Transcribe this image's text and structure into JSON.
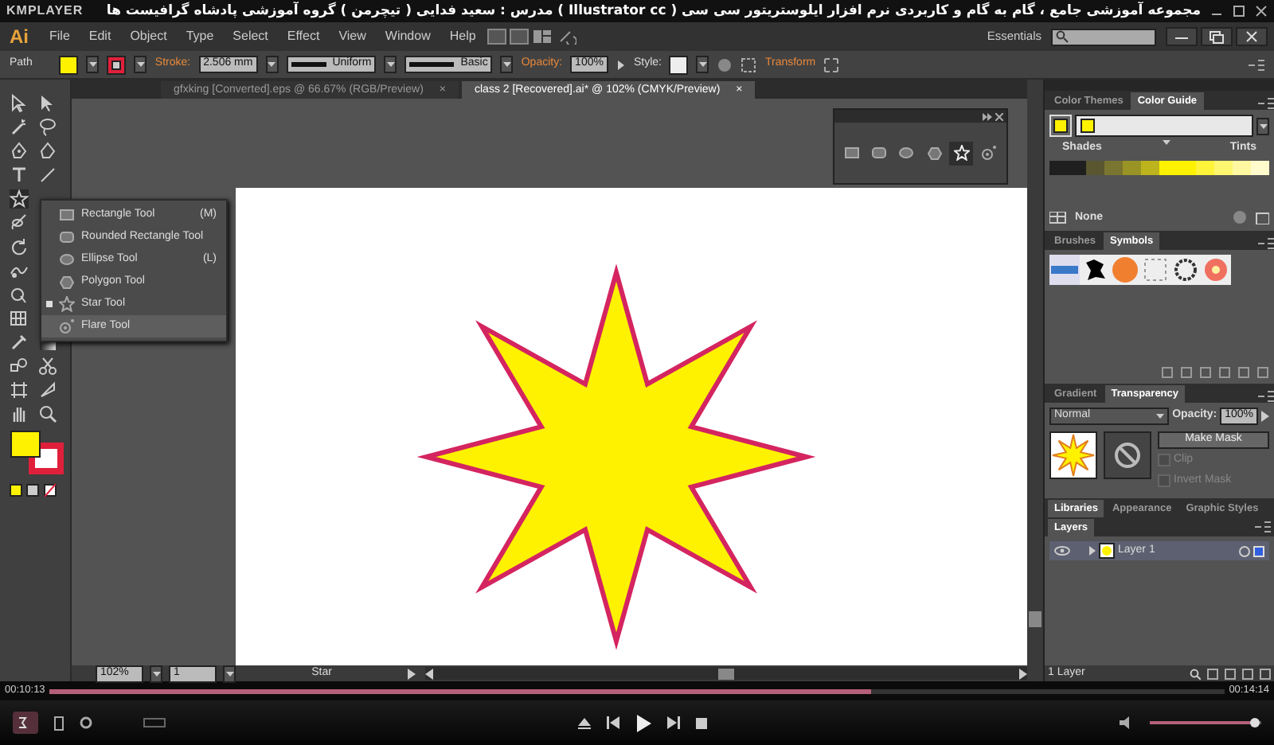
{
  "player": {
    "name": "KMPLAYER",
    "title": "مجموعه آموزشی جامع ، گام به گام و کاربردی نرم افزار ایلوستریتور سی سی ( Illustrator cc ) مدرس : سعید فدایی ( تیچرمن ) گروه آموزشی پادشاه گرافیست ها",
    "elapsed": "00:10:13",
    "total": "00:14:14",
    "progress": {
      "level": 0.7
    },
    "volume": {
      "level": 0.9
    }
  },
  "app": {
    "logo": "Ai",
    "menus": [
      "File",
      "Edit",
      "Object",
      "Type",
      "Select",
      "Effect",
      "View",
      "Window",
      "Help"
    ],
    "workspace": "Essentials"
  },
  "control_bar": {
    "selection": "Path",
    "stroke_label": "Stroke:",
    "stroke_weight": "2.506 mm",
    "profile": "Uniform",
    "brush": "Basic",
    "opacity_label": "Opacity:",
    "opacity": "100%",
    "style_label": "Style:",
    "transform": "Transform"
  },
  "documents": [
    {
      "title": "gfxking [Converted].eps @ 66.67% (RGB/Preview)",
      "close": "×",
      "selected": false
    },
    {
      "title": "class 2 [Recovered].ai* @ 102% (CMYK/Preview)",
      "close": "×",
      "selected": true
    }
  ],
  "flyout": [
    {
      "kind": "rect",
      "label": "Rectangle Tool",
      "shortcut": "(M)",
      "current": false,
      "hovered": false
    },
    {
      "kind": "rounded",
      "label": "Rounded Rectangle Tool",
      "current": false,
      "hovered": false
    },
    {
      "kind": "ellipse",
      "label": "Ellipse Tool",
      "shortcut": "(L)",
      "current": false,
      "hovered": false
    },
    {
      "kind": "polygon",
      "label": "Polygon Tool",
      "current": false,
      "hovered": false
    },
    {
      "kind": "star",
      "label": "Star Tool",
      "current": true,
      "hovered": false
    },
    {
      "kind": "flare",
      "label": "Flare Tool",
      "current": false,
      "hovered": true
    }
  ],
  "tearoff": [
    {
      "kind": "rect",
      "selected": false
    },
    {
      "kind": "rounded",
      "selected": false
    },
    {
      "kind": "ellipse",
      "selected": false
    },
    {
      "kind": "polygon",
      "selected": false
    },
    {
      "kind": "star",
      "selected": true
    },
    {
      "kind": "flare",
      "selected": false
    }
  ],
  "color_panel": {
    "tabs": [
      {
        "label": "Color Themes",
        "selected": false
      },
      {
        "label": "Color Guide",
        "selected": true
      }
    ],
    "shades": "Shades",
    "tints": "Tints",
    "harmony": "None"
  },
  "symbol_panel": {
    "tabs": [
      {
        "label": "Brushes",
        "selected": false
      },
      {
        "label": "Symbols",
        "selected": true
      }
    ]
  },
  "transparency_panel": {
    "tabs": [
      {
        "label": "Gradient",
        "selected": false
      },
      {
        "label": "Transparency",
        "selected": true
      }
    ],
    "mode": "Normal",
    "opacity_label": "Opacity:",
    "opacity": "100%",
    "make_mask": "Make Mask",
    "clip": {
      "label": "Clip",
      "checked": false
    },
    "invert": {
      "label": "Invert Mask",
      "checked": false
    }
  },
  "library_tabs": [
    {
      "label": "Libraries",
      "selected": true
    },
    {
      "label": "Appearance",
      "selected": false
    },
    {
      "label": "Graphic Styles",
      "selected": false
    }
  ],
  "layers": {
    "title": "Layers",
    "items": [
      {
        "name": "Layer 1",
        "visible": true,
        "selected": true
      }
    ],
    "count": "1 Layer"
  },
  "status": {
    "zoom": "102%",
    "artboard": "1",
    "tool": "Star"
  }
}
